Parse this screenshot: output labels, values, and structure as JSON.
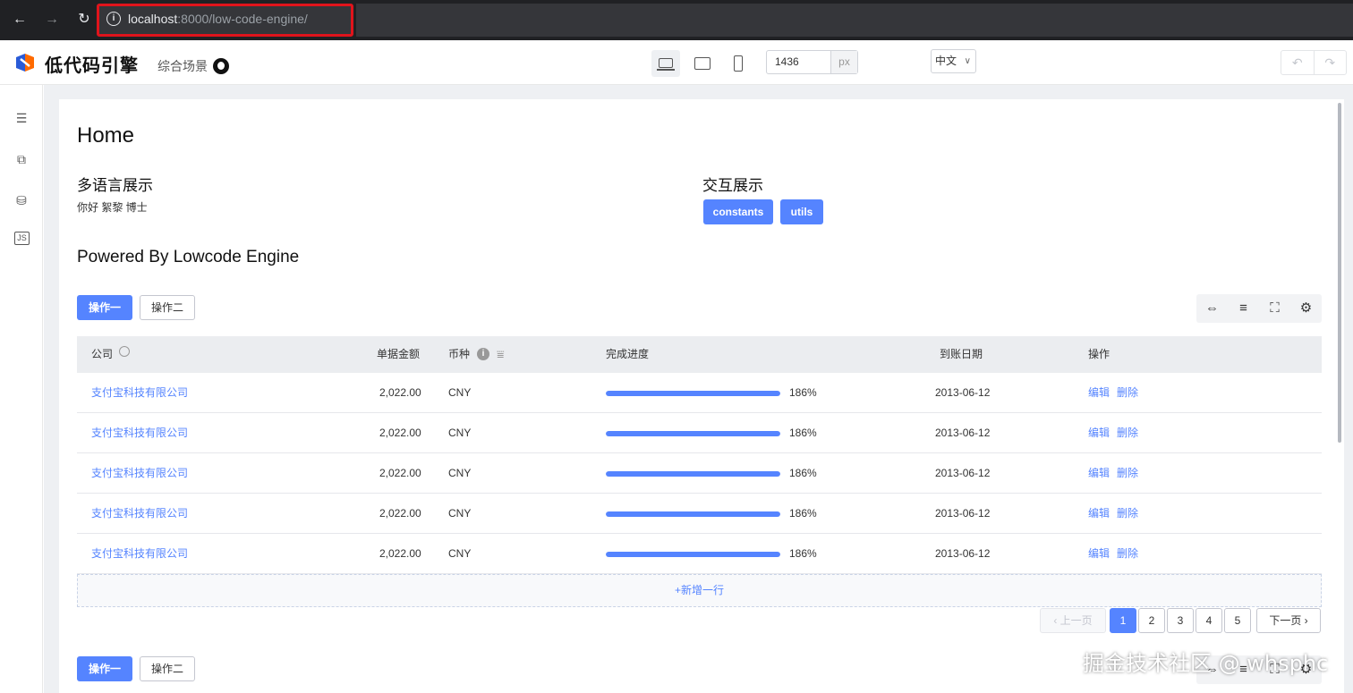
{
  "browser": {
    "url_host": "localhost",
    "url_rest": ":8000/low-code-engine/"
  },
  "header": {
    "brand": "低代码引擎",
    "scene": "综合场景",
    "width_value": "1436",
    "width_unit": "px",
    "language": "中文"
  },
  "left_rail": {
    "items": [
      "outline-icon",
      "component-icon",
      "datasource-icon",
      "js-icon"
    ]
  },
  "page": {
    "title": "Home",
    "i18n_title": "多语言展示",
    "i18n_text": "你好  絮黎 博士",
    "interact_title": "交互展示",
    "btn_constants": "constants",
    "btn_utils": "utils",
    "powered": "Powered By Lowcode Engine",
    "action_one": "操作一",
    "action_two": "操作二"
  },
  "table": {
    "columns": [
      "公司",
      "单据金额",
      "币种",
      "完成进度",
      "到账日期",
      "操作"
    ],
    "rows": [
      {
        "company": "支付宝科技有限公司",
        "amount": "2,022.00",
        "currency": "CNY",
        "progress_pct": 100,
        "progress_label": "186%",
        "date": "2013-06-12",
        "edit": "编辑",
        "delete": "删除"
      },
      {
        "company": "支付宝科技有限公司",
        "amount": "2,022.00",
        "currency": "CNY",
        "progress_pct": 100,
        "progress_label": "186%",
        "date": "2013-06-12",
        "edit": "编辑",
        "delete": "删除"
      },
      {
        "company": "支付宝科技有限公司",
        "amount": "2,022.00",
        "currency": "CNY",
        "progress_pct": 100,
        "progress_label": "186%",
        "date": "2013-06-12",
        "edit": "编辑",
        "delete": "删除"
      },
      {
        "company": "支付宝科技有限公司",
        "amount": "2,022.00",
        "currency": "CNY",
        "progress_pct": 100,
        "progress_label": "186%",
        "date": "2013-06-12",
        "edit": "编辑",
        "delete": "删除"
      },
      {
        "company": "支付宝科技有限公司",
        "amount": "2,022.00",
        "currency": "CNY",
        "progress_pct": 100,
        "progress_label": "186%",
        "date": "2013-06-12",
        "edit": "编辑",
        "delete": "删除"
      }
    ],
    "add_row": "+新增一行"
  },
  "pagination": {
    "prev": "上一页",
    "pages": [
      "1",
      "2",
      "3",
      "4",
      "5"
    ],
    "current": "1",
    "next": "下一页"
  },
  "watermark": "掘金技术社区 @ whsphc",
  "colors": {
    "primary": "#5584ff",
    "url_highlight": "#e0141c"
  }
}
